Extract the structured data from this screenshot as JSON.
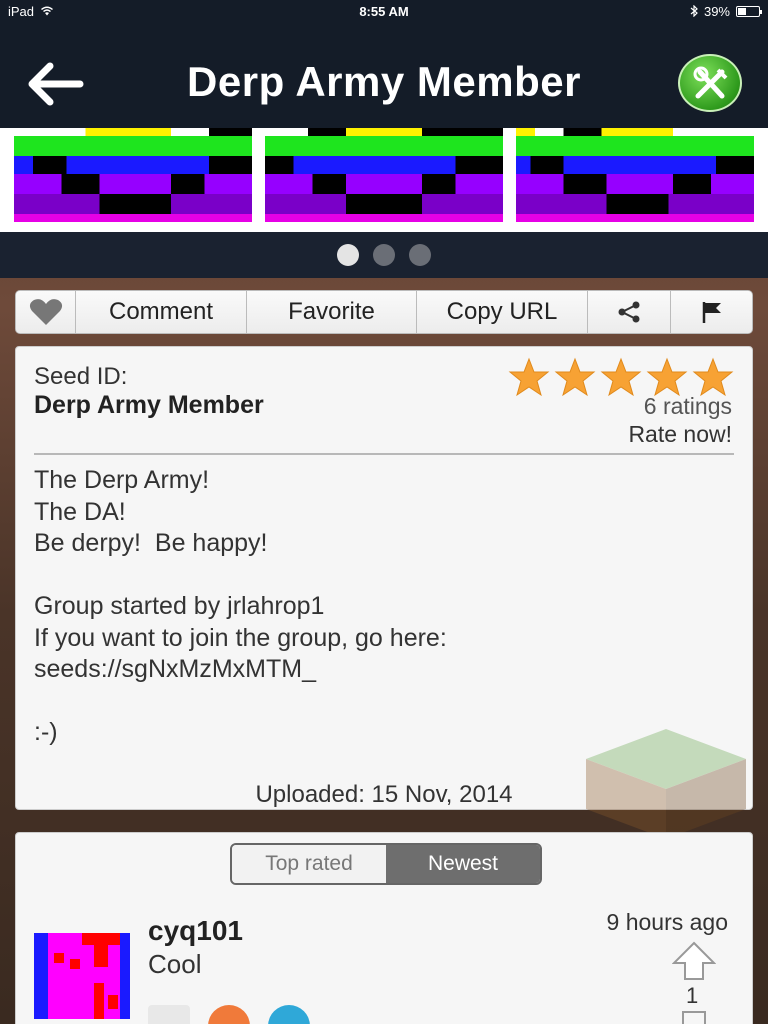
{
  "status_bar": {
    "device": "iPad",
    "time": "8:55 AM",
    "battery": "39%"
  },
  "nav": {
    "title": "Derp Army Member",
    "back_icon": "back-arrow-icon",
    "tools_icon": "tools-icon"
  },
  "gallery": {
    "images": 3,
    "pages": 3,
    "active_page": 0
  },
  "toolbar": {
    "like_icon": "heart-icon",
    "comment": "Comment",
    "favorite": "Favorite",
    "copy_url": "Copy URL",
    "share_icon": "share-icon",
    "flag_icon": "flag-icon"
  },
  "seed": {
    "label": "Seed ID:",
    "name": "Derp Army Member",
    "stars": 5,
    "ratings": "6 ratings",
    "rate_now": "Rate now!",
    "description": "The Derp Army!\nThe DA!\nBe derpy!  Be happy!\n\nGroup started by jrlahrop1\nIf you want to join the group, go here:\nseeds://sgNxMzMxMTM_\n\n:-)",
    "uploaded": "Uploaded: 15 Nov, 2014"
  },
  "comments": {
    "tabs": [
      "Top rated",
      "Newest"
    ],
    "active_tab": 1,
    "items": [
      {
        "user": "cyq101",
        "text": "Cool",
        "time": "9 hours ago",
        "votes": "1"
      }
    ]
  },
  "colors": {
    "nav_bg": "#141c28",
    "star": "#f7a234",
    "tools_green": "#2e9a1c"
  }
}
